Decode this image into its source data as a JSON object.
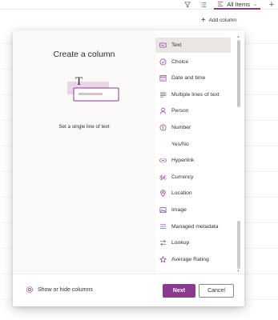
{
  "topbar": {
    "view_label": "All Items",
    "filter_icon": "filter-icon",
    "list_icon": "list-view-icon",
    "new_icon": "plus-icon"
  },
  "header": {
    "add_column_label": "Add column"
  },
  "panel": {
    "title": "Create a column",
    "description": "Set a single line of text",
    "column_types": [
      {
        "label": "Text",
        "icon": "text-field-icon",
        "selected": true
      },
      {
        "label": "Choice",
        "icon": "choice-icon"
      },
      {
        "label": "Date and time",
        "icon": "calendar-icon"
      },
      {
        "label": "Multiple lines of text",
        "icon": "multiline-text-icon"
      },
      {
        "label": "Person",
        "icon": "person-icon"
      },
      {
        "label": "Number",
        "icon": "number-icon"
      },
      {
        "label": "Yes/No",
        "icon": ""
      },
      {
        "label": "Hyperlink",
        "icon": "link-icon"
      },
      {
        "label": "Currency",
        "icon": "currency-icon"
      },
      {
        "label": "Location",
        "icon": "location-icon"
      },
      {
        "label": "Image",
        "icon": "image-icon"
      },
      {
        "label": "Managed metadata",
        "icon": "tag-icon"
      },
      {
        "label": "Lookup",
        "icon": "lookup-icon"
      },
      {
        "label": "Average Rating",
        "icon": "star-icon"
      }
    ],
    "show_hide_label": "Show or hide columns",
    "next_label": "Next",
    "cancel_label": "Cancel"
  },
  "colors": {
    "accent": "#8a3a8f",
    "selected_bg": "#e9e6e4",
    "pane_bg": "#faf9f8"
  }
}
